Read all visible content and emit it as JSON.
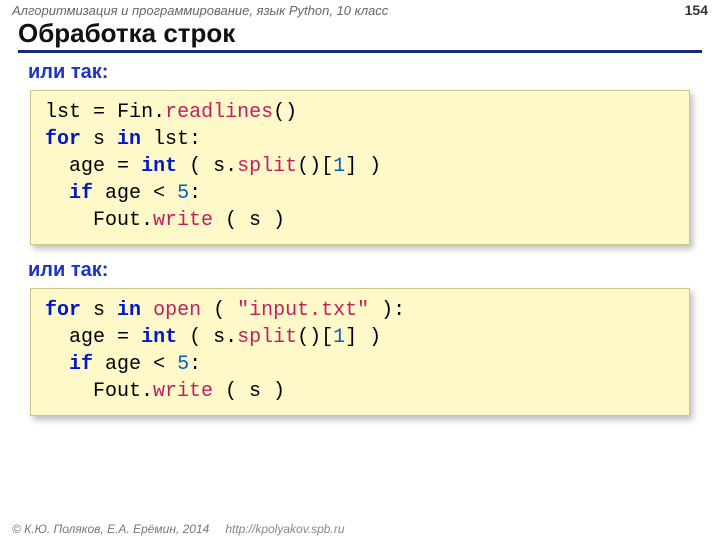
{
  "header": {
    "course": "Алгоритмизация и программирование, язык Python, 10 класс",
    "pagenum": "154"
  },
  "title": "Обработка строк",
  "sub1": "или так:",
  "sub2": "или так:",
  "code1": {
    "l1a": "lst",
    "l1b": "=",
    "l1c": "Fin.",
    "l1d": "readlines",
    "l1e": "()",
    "l2a": "for",
    "l2b": " s ",
    "l2c": "in",
    "l2d": " lst:",
    "l3a": "  age",
    "l3b": "=",
    "l3c": "int",
    "l3d": " ( s.",
    "l3e": "split",
    "l3f": "()[",
    "l3g": "1",
    "l3h": "] )",
    "l4a": "  ",
    "l4b": "if",
    "l4c": " age",
    "l4d": "<",
    "l4e": "5",
    "l4f": ":",
    "l5a": "    Fout.",
    "l5b": "write",
    "l5c": " ( s )"
  },
  "code2": {
    "l1a": "for",
    "l1b": " s ",
    "l1c": "in",
    "l1d": " ",
    "l1e": "open",
    "l1f": " ( ",
    "l1g": "\"input.txt\"",
    "l1h": " ):",
    "l2a": "  age",
    "l2b": "=",
    "l2c": "int",
    "l2d": " ( s.",
    "l2e": "split",
    "l2f": "()[",
    "l2g": "1",
    "l2h": "] )",
    "l3a": "  ",
    "l3b": "if",
    "l3c": " age",
    "l3d": "<",
    "l3e": "5",
    "l3f": ":",
    "l4a": "    Fout.",
    "l4b": "write",
    "l4c": " ( s )"
  },
  "footer": {
    "copyright": "© К.Ю. Поляков, Е.А. Ерёмин, 2014",
    "url": "http://kpolyakov.spb.ru"
  }
}
